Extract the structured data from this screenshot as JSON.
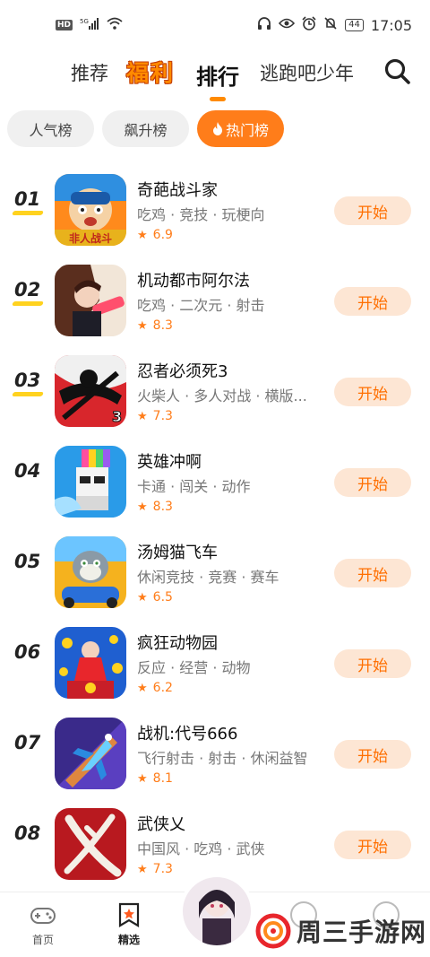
{
  "status_bar": {
    "hd_label": "HD",
    "signal_label": "5G",
    "battery_label": "44",
    "time": "17:05"
  },
  "top_nav": {
    "tabs": [
      {
        "label": "推荐"
      },
      {
        "label": "福利"
      },
      {
        "label": "排行"
      },
      {
        "label": "逃跑吧少年"
      }
    ],
    "active_tab": "排行",
    "search_icon": "search-icon"
  },
  "sub_tabs": [
    {
      "label": "人气榜"
    },
    {
      "label": "飙升榜"
    },
    {
      "label": "热门榜"
    }
  ],
  "active_sub_tab": "热门榜",
  "games": [
    {
      "rank": "01",
      "name": "奇葩战斗家",
      "tags": "吃鸡 · 竞技 · 玩梗向",
      "score": "6.9",
      "button": "开始",
      "icon_text": "非人战斗"
    },
    {
      "rank": "02",
      "name": "机动都市阿尔法",
      "tags": "吃鸡 · 二次元 · 射击",
      "score": "8.3",
      "button": "开始"
    },
    {
      "rank": "03",
      "name": "忍者必须死3",
      "tags": "火柴人 · 多人对战 · 横版...",
      "score": "7.3",
      "button": "开始",
      "icon_text": "3"
    },
    {
      "rank": "04",
      "name": "英雄冲啊",
      "tags": "卡通 · 闯关 · 动作",
      "score": "8.3",
      "button": "开始"
    },
    {
      "rank": "05",
      "name": "汤姆猫飞车",
      "tags": "休闲竞技 · 竞赛 · 赛车",
      "score": "6.5",
      "button": "开始"
    },
    {
      "rank": "06",
      "name": "疯狂动物园",
      "tags": "反应 · 经营 · 动物",
      "score": "6.2",
      "button": "开始"
    },
    {
      "rank": "07",
      "name": "战机:代号666",
      "tags": "飞行射击 · 射击 · 休闲益智",
      "score": "8.1",
      "button": "开始"
    },
    {
      "rank": "08",
      "name": "武侠乂",
      "tags": "中国风 · 吃鸡 · 武侠",
      "score": "7.3",
      "button": "开始"
    }
  ],
  "bottom_bar": {
    "home_label": "首页",
    "featured_label": "精选"
  },
  "watermark": "周三手游网",
  "colors": {
    "accent": "#ff7d1a",
    "button_bg": "#fde6d4",
    "rank_highlight": "#ffd21f"
  }
}
